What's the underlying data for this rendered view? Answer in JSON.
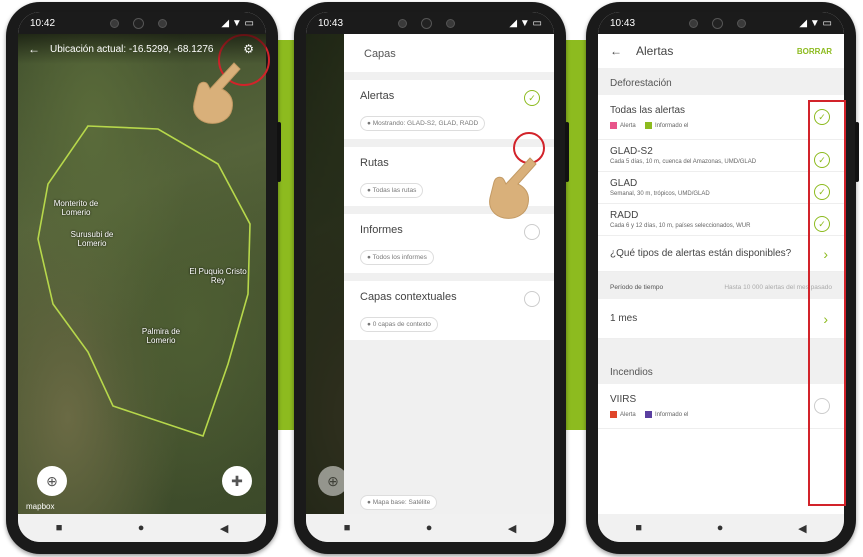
{
  "colors": {
    "brand_green": "#8dbb1f",
    "highlight_red": "#d2232a",
    "alert_pink": "#e8558a",
    "alert_green": "#8dbb1f",
    "fire_red": "#e0452a",
    "fire_purple": "#5a3fa0"
  },
  "phone1": {
    "time": "10:42",
    "location_text": "Ubicación actual: -16.5299, -68.1276",
    "map_labels": [
      "Monterito de Lomerio",
      "Surusubi de Lomerio",
      "El Puquio Cristo Rey",
      "Palmira de Lomerio"
    ],
    "attribution": "mapbox"
  },
  "phone2": {
    "time": "10:43",
    "title": "Capas",
    "layers": [
      {
        "title": "Alertas",
        "chip": "Mostrando: GLAD-S2, GLAD, RADD",
        "checked": true
      },
      {
        "title": "Rutas",
        "chip": "Todas las rutas",
        "checked": false
      },
      {
        "title": "Informes",
        "chip": "Todos los informes",
        "checked": false
      },
      {
        "title": "Capas contextuales",
        "chip": "0 capas de contexto",
        "checked": false
      }
    ],
    "basemap_chip": "Mapa base: Satélite"
  },
  "phone3": {
    "time": "10:43",
    "title": "Alertas",
    "clear": "BORRAR",
    "deforestation": "Deforestación",
    "all_alerts": "Todas las alertas",
    "legend_alert": "Alerta",
    "legend_reported": "Informado el",
    "rows": [
      {
        "title": "GLAD-S2",
        "sub": "Cada 5 días, 10 m, cuenca del Amazonas, UMD/GLAD"
      },
      {
        "title": "GLAD",
        "sub": "Semanal, 30 m, trópicos, UMD/GLAD"
      },
      {
        "title": "RADD",
        "sub": "Cada 6 y 12 días, 10 m, países seleccionados, WUR"
      }
    ],
    "types_question": "¿Qué tipos de alertas están disponibles?",
    "period_label": "Período de tiempo",
    "period_hint": "Hasta 10 000 alertas del mes pasado",
    "period_value": "1 mes",
    "fires": "Incendios",
    "viirs": "VIIRS"
  }
}
